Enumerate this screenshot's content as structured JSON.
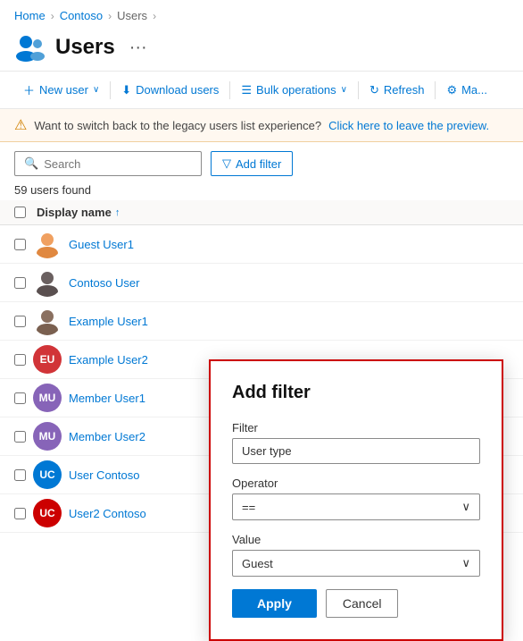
{
  "breadcrumb": {
    "items": [
      "Home",
      "Contoso",
      "Users"
    ],
    "separators": [
      ">",
      ">"
    ]
  },
  "page": {
    "title": "Users",
    "icon_label": "users-icon"
  },
  "toolbar": {
    "new_user": "New user",
    "download_users": "Download users",
    "bulk_operations": "Bulk operations",
    "refresh": "Refresh",
    "manage": "Ma..."
  },
  "banner": {
    "text": "Want to switch back to the legacy users list experience?",
    "link_text": "Click here to leave the preview."
  },
  "filter_area": {
    "search_placeholder": "Search",
    "add_filter_label": "Add filter"
  },
  "users_count": "59 users found",
  "table": {
    "col_display_name": "Display name",
    "sort_direction": "↑",
    "rows": [
      {
        "name": "Guest User1",
        "avatar_type": "image",
        "avatar_color": "",
        "initials": ""
      },
      {
        "name": "Contoso User",
        "avatar_type": "image",
        "avatar_color": "",
        "initials": ""
      },
      {
        "name": "Example User1",
        "avatar_type": "image",
        "avatar_color": "",
        "initials": ""
      },
      {
        "name": "Example User2",
        "avatar_type": "circle",
        "avatar_color": "#d13438",
        "initials": "EU"
      },
      {
        "name": "Member User1",
        "avatar_type": "circle",
        "avatar_color": "#8764b8",
        "initials": "MU"
      },
      {
        "name": "Member User2",
        "avatar_type": "circle",
        "avatar_color": "#8764b8",
        "initials": "MU"
      },
      {
        "name": "User Contoso",
        "avatar_type": "circle",
        "avatar_color": "#0078d4",
        "initials": "UC"
      },
      {
        "name": "User2 Contoso",
        "avatar_type": "circle",
        "avatar_color": "#c00",
        "initials": "UC"
      }
    ]
  },
  "filter_panel": {
    "title": "Add filter",
    "filter_label": "Filter",
    "filter_value": "User type",
    "operator_label": "Operator",
    "operator_value": "==",
    "value_label": "Value",
    "value_value": "Guest",
    "apply_label": "Apply",
    "cancel_label": "Cancel"
  }
}
